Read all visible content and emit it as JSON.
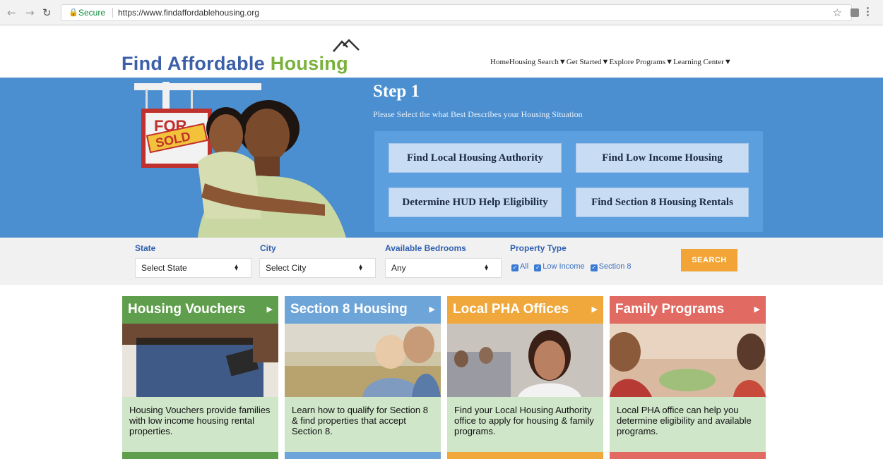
{
  "browser": {
    "secure_label": "Secure",
    "url": "https://www.findaffordablehousing.org"
  },
  "header": {
    "logo_part1": "Find Affordable ",
    "logo_part2": "Housing",
    "nav": [
      "Home",
      "Housing Search▼",
      "Get Started▼",
      "Explore Programs▼",
      "Learning Center▼"
    ]
  },
  "hero": {
    "title": "Step 1",
    "subtitle": "Please Select the what Best Describes your Housing Situation",
    "buttons": [
      "Find Local Housing Authority",
      "Find Low Income Housing",
      "Determine HUD Help Eligibility",
      "Find Section 8 Housing Rentals"
    ],
    "sign_text_1": "FOR",
    "sign_text_2": "SOLD"
  },
  "search": {
    "state_label": "State",
    "state_value": "Select State",
    "city_label": "City",
    "city_value": "Select City",
    "bedrooms_label": "Available Bedrooms",
    "bedrooms_value": "Any",
    "property_label": "Property Type",
    "checkboxes": [
      "All",
      "Low Income",
      "Section 8"
    ],
    "search_button": "SEARCH"
  },
  "cards": [
    {
      "title": "Housing Vouchers",
      "text": "Housing Vouchers provide families with low income housing rental properties.",
      "color": "#5f9e4c"
    },
    {
      "title": "Section 8 Housing",
      "text": "Learn how to qualify for Section 8 & find properties that accept Section 8.",
      "color": "#6ea5d8"
    },
    {
      "title": "Local PHA Offices",
      "text": "Find your Local Housing Authority office to apply for housing & family programs.",
      "color": "#f0a83c"
    },
    {
      "title": "Family Programs",
      "text": "Local PHA office can help you determine eligibility and available programs.",
      "color": "#e16a62"
    }
  ]
}
